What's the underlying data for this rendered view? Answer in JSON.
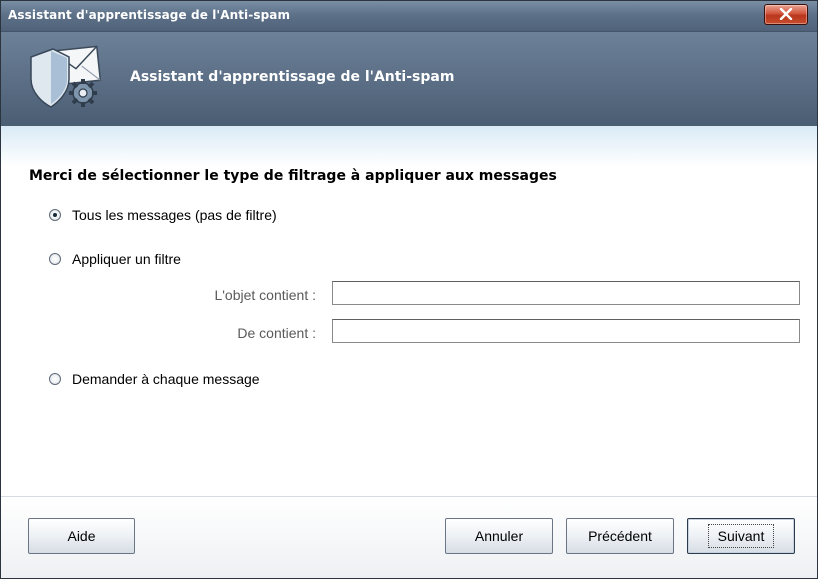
{
  "window": {
    "title": "Assistant d'apprentissage de l'Anti-spam"
  },
  "header": {
    "title": "Assistant d'apprentissage de l'Anti-spam",
    "icon": "shield-mail-gear-icon"
  },
  "main": {
    "question": "Merci de sélectionner le type de filtrage à appliquer aux messages",
    "options": [
      {
        "label": "Tous les messages (pas de filtre)",
        "selected": true
      },
      {
        "label": "Appliquer un filtre",
        "selected": false
      },
      {
        "label": "Demander à chaque message",
        "selected": false
      }
    ],
    "filters": {
      "subject_label": "L'objet contient :",
      "subject_value": "",
      "from_label": "De contient :",
      "from_value": ""
    }
  },
  "footer": {
    "help": "Aide",
    "cancel": "Annuler",
    "previous": "Précédent",
    "next": "Suivant"
  },
  "colors": {
    "titlebar": "#5d7189",
    "header": "#4a5d73",
    "close": "#c94d2c"
  }
}
